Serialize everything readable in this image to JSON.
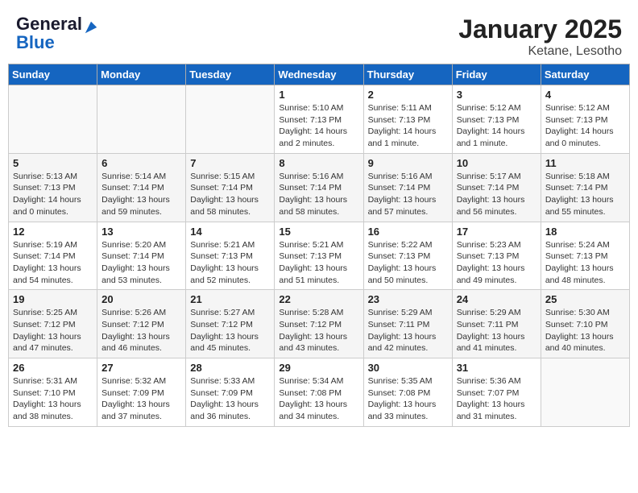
{
  "header": {
    "logo_line1": "General",
    "logo_line2": "Blue",
    "month": "January 2025",
    "location": "Ketane, Lesotho"
  },
  "days_of_week": [
    "Sunday",
    "Monday",
    "Tuesday",
    "Wednesday",
    "Thursday",
    "Friday",
    "Saturday"
  ],
  "weeks": [
    [
      {
        "day": "",
        "info": ""
      },
      {
        "day": "",
        "info": ""
      },
      {
        "day": "",
        "info": ""
      },
      {
        "day": "1",
        "info": "Sunrise: 5:10 AM\nSunset: 7:13 PM\nDaylight: 14 hours\nand 2 minutes."
      },
      {
        "day": "2",
        "info": "Sunrise: 5:11 AM\nSunset: 7:13 PM\nDaylight: 14 hours\nand 1 minute."
      },
      {
        "day": "3",
        "info": "Sunrise: 5:12 AM\nSunset: 7:13 PM\nDaylight: 14 hours\nand 1 minute."
      },
      {
        "day": "4",
        "info": "Sunrise: 5:12 AM\nSunset: 7:13 PM\nDaylight: 14 hours\nand 0 minutes."
      }
    ],
    [
      {
        "day": "5",
        "info": "Sunrise: 5:13 AM\nSunset: 7:13 PM\nDaylight: 14 hours\nand 0 minutes."
      },
      {
        "day": "6",
        "info": "Sunrise: 5:14 AM\nSunset: 7:14 PM\nDaylight: 13 hours\nand 59 minutes."
      },
      {
        "day": "7",
        "info": "Sunrise: 5:15 AM\nSunset: 7:14 PM\nDaylight: 13 hours\nand 58 minutes."
      },
      {
        "day": "8",
        "info": "Sunrise: 5:16 AM\nSunset: 7:14 PM\nDaylight: 13 hours\nand 58 minutes."
      },
      {
        "day": "9",
        "info": "Sunrise: 5:16 AM\nSunset: 7:14 PM\nDaylight: 13 hours\nand 57 minutes."
      },
      {
        "day": "10",
        "info": "Sunrise: 5:17 AM\nSunset: 7:14 PM\nDaylight: 13 hours\nand 56 minutes."
      },
      {
        "day": "11",
        "info": "Sunrise: 5:18 AM\nSunset: 7:14 PM\nDaylight: 13 hours\nand 55 minutes."
      }
    ],
    [
      {
        "day": "12",
        "info": "Sunrise: 5:19 AM\nSunset: 7:14 PM\nDaylight: 13 hours\nand 54 minutes."
      },
      {
        "day": "13",
        "info": "Sunrise: 5:20 AM\nSunset: 7:14 PM\nDaylight: 13 hours\nand 53 minutes."
      },
      {
        "day": "14",
        "info": "Sunrise: 5:21 AM\nSunset: 7:13 PM\nDaylight: 13 hours\nand 52 minutes."
      },
      {
        "day": "15",
        "info": "Sunrise: 5:21 AM\nSunset: 7:13 PM\nDaylight: 13 hours\nand 51 minutes."
      },
      {
        "day": "16",
        "info": "Sunrise: 5:22 AM\nSunset: 7:13 PM\nDaylight: 13 hours\nand 50 minutes."
      },
      {
        "day": "17",
        "info": "Sunrise: 5:23 AM\nSunset: 7:13 PM\nDaylight: 13 hours\nand 49 minutes."
      },
      {
        "day": "18",
        "info": "Sunrise: 5:24 AM\nSunset: 7:13 PM\nDaylight: 13 hours\nand 48 minutes."
      }
    ],
    [
      {
        "day": "19",
        "info": "Sunrise: 5:25 AM\nSunset: 7:12 PM\nDaylight: 13 hours\nand 47 minutes."
      },
      {
        "day": "20",
        "info": "Sunrise: 5:26 AM\nSunset: 7:12 PM\nDaylight: 13 hours\nand 46 minutes."
      },
      {
        "day": "21",
        "info": "Sunrise: 5:27 AM\nSunset: 7:12 PM\nDaylight: 13 hours\nand 45 minutes."
      },
      {
        "day": "22",
        "info": "Sunrise: 5:28 AM\nSunset: 7:12 PM\nDaylight: 13 hours\nand 43 minutes."
      },
      {
        "day": "23",
        "info": "Sunrise: 5:29 AM\nSunset: 7:11 PM\nDaylight: 13 hours\nand 42 minutes."
      },
      {
        "day": "24",
        "info": "Sunrise: 5:29 AM\nSunset: 7:11 PM\nDaylight: 13 hours\nand 41 minutes."
      },
      {
        "day": "25",
        "info": "Sunrise: 5:30 AM\nSunset: 7:10 PM\nDaylight: 13 hours\nand 40 minutes."
      }
    ],
    [
      {
        "day": "26",
        "info": "Sunrise: 5:31 AM\nSunset: 7:10 PM\nDaylight: 13 hours\nand 38 minutes."
      },
      {
        "day": "27",
        "info": "Sunrise: 5:32 AM\nSunset: 7:09 PM\nDaylight: 13 hours\nand 37 minutes."
      },
      {
        "day": "28",
        "info": "Sunrise: 5:33 AM\nSunset: 7:09 PM\nDaylight: 13 hours\nand 36 minutes."
      },
      {
        "day": "29",
        "info": "Sunrise: 5:34 AM\nSunset: 7:08 PM\nDaylight: 13 hours\nand 34 minutes."
      },
      {
        "day": "30",
        "info": "Sunrise: 5:35 AM\nSunset: 7:08 PM\nDaylight: 13 hours\nand 33 minutes."
      },
      {
        "day": "31",
        "info": "Sunrise: 5:36 AM\nSunset: 7:07 PM\nDaylight: 13 hours\nand 31 minutes."
      },
      {
        "day": "",
        "info": ""
      }
    ]
  ]
}
